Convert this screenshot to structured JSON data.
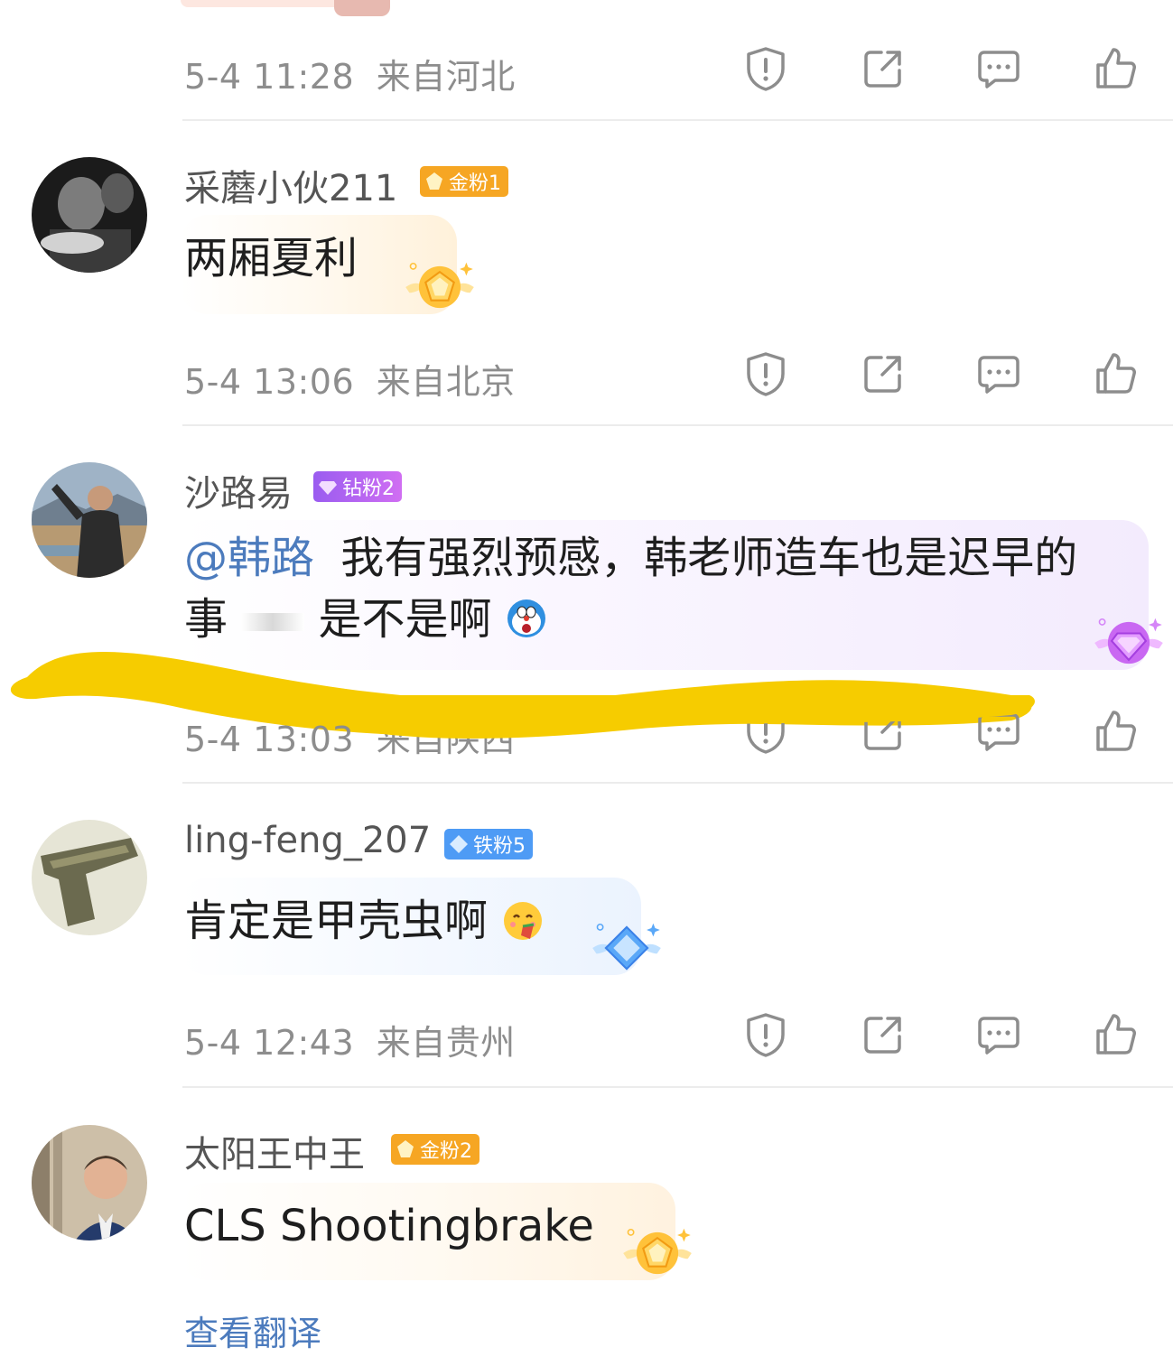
{
  "comments": [
    {
      "timestamp": "5-4 11:28",
      "location": "来自河北"
    },
    {
      "username": "采蘑小伙211",
      "badge": "金粉1",
      "text": "两厢夏利",
      "timestamp": "5-4 13:06",
      "location": "来自北京",
      "avatar_icon": "avatar-dark-photo"
    },
    {
      "username": "沙路易",
      "badge": "钻粉2",
      "mention": "@韩路",
      "text_line1": "我有强烈预感，韩老师造车也是迟早的",
      "text_line2_start": "事",
      "text_line2_end": "是不是啊",
      "emoji_icon": "doraemon-emoji-icon",
      "timestamp": "5-4 13:03",
      "location": "来自陕西",
      "avatar_icon": "avatar-man-waving-photo"
    },
    {
      "username": "ling-feng_207",
      "badge": "铁粉5",
      "text": "肯定是甲壳虫啊",
      "emoji_icon": "yummy-face-emoji-icon",
      "timestamp": "5-4 12:43",
      "location": "来自贵州",
      "avatar_icon": "avatar-gun-photo"
    },
    {
      "username": "太阳王中王",
      "badge": "金粉2",
      "text": "CLS Shootingbrake",
      "translate_link": "查看翻译",
      "avatar_icon": "avatar-smiling-man-photo"
    }
  ],
  "action_icons": [
    "report-icon",
    "share-icon",
    "reply-icon",
    "like-icon"
  ],
  "colors": {
    "gold_badge": "#f6a623",
    "diamond_badge": "#b26ef0",
    "iron_badge": "#4e9bf5",
    "mention": "#4c7bbd",
    "scribble": "#f6cc00",
    "meta_gray": "#8d8d8d"
  }
}
